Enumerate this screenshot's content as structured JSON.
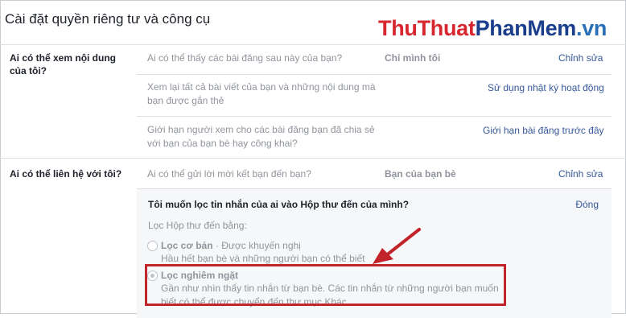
{
  "page_title": "Cài đặt quyền riêng tư và công cụ",
  "watermark": {
    "part1": "Thu",
    "part2": "Thuat",
    "part3": "PhanMem",
    "part4": ".vn"
  },
  "sections": [
    {
      "label": "Ai có thể xem nội dung của tôi?",
      "rows": [
        {
          "question": "Ai có thể thấy các bài đăng sau này của bạn?",
          "value": "Chỉ mình tôi",
          "action": "Chỉnh sửa"
        },
        {
          "question": "Xem lại tất cả bài viết của bạn và những nội dung mà bạn được gắn thẻ",
          "value": "",
          "action": "Sử dụng nhật ký hoạt động"
        },
        {
          "question": "Giới hạn người xem cho các bài đăng bạn đã chia sẻ với bạn của bạn bè hay công khai?",
          "value": "",
          "action": "Giới hạn bài đăng trước đây"
        }
      ]
    },
    {
      "label": "Ai có thể liên hệ với tôi?",
      "rows": [
        {
          "question": "Ai có thể gửi lời mời kết bạn đến bạn?",
          "value": "Bạn của bạn bè",
          "action": "Chỉnh sửa"
        }
      ]
    }
  ],
  "filter_panel": {
    "title": "Tôi muốn lọc tin nhắn của ai vào Hộp thư đến của mình?",
    "close": "Đóng",
    "subtitle": "Lọc Hộp thư đến bằng:",
    "options": [
      {
        "label": "Lọc cơ bản",
        "tag": " · Được khuyến nghị",
        "desc": "Hầu hết bạn bè và những người bạn có thể biết",
        "checked": false
      },
      {
        "label": "Lọc nghiêm ngặt",
        "tag": "",
        "desc": "Gần như nhìn thấy tin nhắn từ bạn bè. Các tin nhắn từ những người bạn muốn biết có thể được chuyển đến thư mục Khác.",
        "checked": true
      }
    ]
  },
  "colors": {
    "link": "#365899",
    "muted": "#90949c",
    "highlight": "#c1252b",
    "arrow": "#c1252b"
  }
}
